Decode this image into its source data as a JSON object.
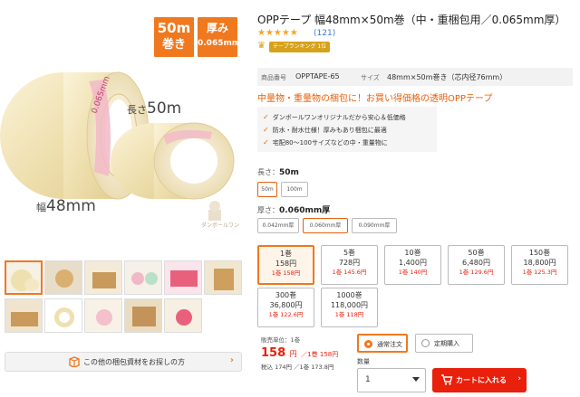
{
  "badges": [
    {
      "line1": "50m",
      "line2": "巻き"
    },
    {
      "line1": "厚み",
      "line2": "0.065mm"
    }
  ],
  "photo_labels": {
    "length_prefix": "長さ",
    "length_value": "50m",
    "width_prefix": "幅",
    "width_value": "48mm",
    "tape_print": "0.065mm",
    "watermark": "ダンボールワン"
  },
  "search_button": {
    "label": "この他の梱包資材をお探しの方",
    "icon": "box-icon"
  },
  "product": {
    "title": "OPPテープ 幅48mm×50m巻（中・重梱包用／0.065mm厚）",
    "stars": "★★★★★",
    "review_count": "(121)",
    "ranking_label": "テープランキング 1位"
  },
  "spec": {
    "code_key": "商品番号",
    "code_value": "OPPTAPE-65",
    "size_key": "サイズ",
    "size_value": "48mm×50m巻き（芯内径76mm）"
  },
  "headline": "中量物・重量物の梱包に！お買い得価格の透明OPPテープ",
  "bullets": [
    "ダンボールワンオリジナルだから安心＆低価格",
    "防水・耐水仕様！厚みもあり梱包に最適",
    "宅配80～100サイズなどの中・重量物に"
  ],
  "length_option": {
    "label": "長さ：",
    "selected": "50m",
    "options": [
      "50m",
      "100m"
    ]
  },
  "thickness_option": {
    "label": "厚さ：",
    "selected": "0.060mm厚",
    "options": [
      "0.042mm厚",
      "0.060mm厚",
      "0.090mm厚"
    ]
  },
  "quantities": [
    {
      "qty": "1巻",
      "price": "158円",
      "unit": "1巻 158円"
    },
    {
      "qty": "5巻",
      "price": "728円",
      "unit": "1巻 145.6円"
    },
    {
      "qty": "10巻",
      "price": "1,400円",
      "unit": "1巻 140円"
    },
    {
      "qty": "50巻",
      "price": "6,480円",
      "unit": "1巻 129.6円"
    },
    {
      "qty": "150巻",
      "price": "18,800円",
      "unit": "1巻 125.3円"
    },
    {
      "qty": "300巻",
      "price": "36,800円",
      "unit": "1巻 122.6円"
    },
    {
      "qty": "1000巻",
      "price": "118,000円",
      "unit": "1巻 118円"
    }
  ],
  "purchase": {
    "unit_label": "販売単位：1巻",
    "price": "158",
    "yen": "円",
    "per_unit": "／1巻 158円",
    "tax_line": "税込 174円 ／1巻 173.8円",
    "order_normal": "通常注文",
    "order_subscription": "定期購入",
    "qty_label": "数量",
    "qty_value": "1",
    "cart_label": "カートに入れる",
    "cart_icon": "cart-icon"
  },
  "colors": {
    "accent": "#f0781e",
    "price_red": "#e8200c",
    "rank_gold": "#d6a21c"
  }
}
